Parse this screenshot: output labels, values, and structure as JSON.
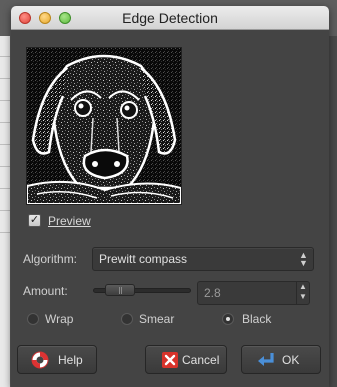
{
  "window": {
    "title": "Edge Detection"
  },
  "preview": {
    "label": "Preview",
    "checked": true
  },
  "algorithm": {
    "label": "Algorithm:",
    "value": "Prewitt compass"
  },
  "amount": {
    "label": "Amount:",
    "value": "2.8"
  },
  "edge_mode": {
    "options": [
      "Wrap",
      "Smear",
      "Black"
    ],
    "selected": "Black"
  },
  "buttons": {
    "help": "Help",
    "cancel": "Cancel",
    "ok": "OK"
  },
  "icons": {
    "close": "close-traffic-light",
    "minimize": "minimize-traffic-light",
    "zoom": "zoom-traffic-light",
    "help": "lifebuoy-icon",
    "cancel": "red-x-icon",
    "ok": "return-arrow-icon",
    "combo": "up-down-arrows-icon"
  },
  "colors": {
    "dialog_bg": "#444444",
    "titlebar": "#dcdcdc",
    "field_bg": "#3a3a3a",
    "cancel_x": "#d7332b",
    "ok_arrow": "#4a8fd8"
  }
}
